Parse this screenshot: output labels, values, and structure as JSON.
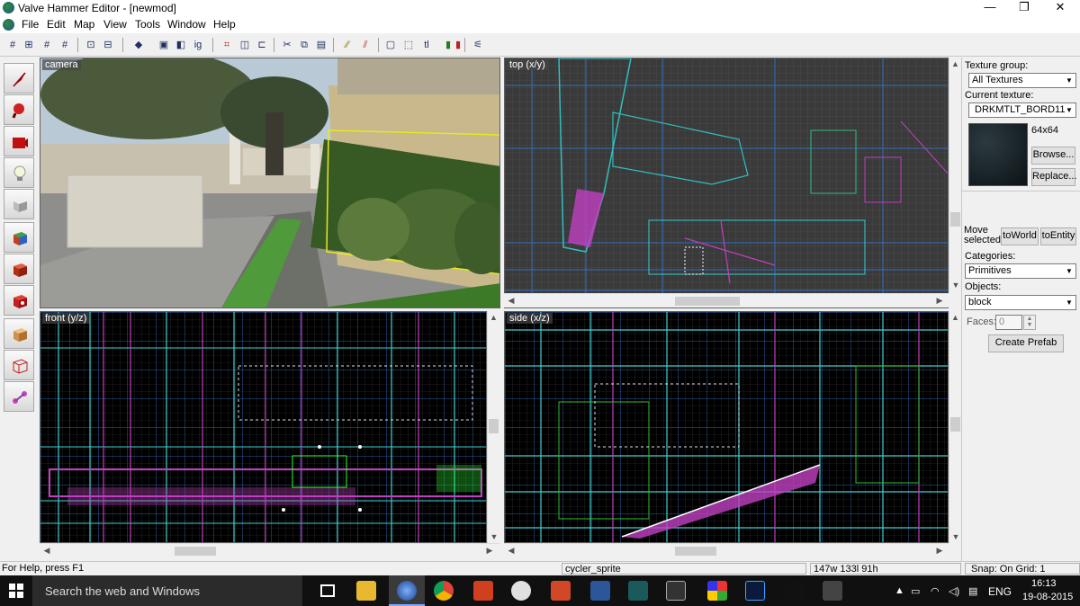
{
  "window": {
    "title": "Valve Hammer Editor - [newmod]",
    "min": "—",
    "restore": "❐",
    "close": "✕"
  },
  "menu": [
    "File",
    "Edit",
    "Map",
    "View",
    "Tools",
    "Window",
    "Help"
  ],
  "mdi": {
    "min": "_",
    "restore": "❐",
    "close": "×"
  },
  "viewports": {
    "camera": "camera",
    "top": "top (x/y)",
    "front": "front (y/z)",
    "side": "side (x/z)"
  },
  "panel": {
    "texture_group_label": "Texture group:",
    "texture_group_value": "All Textures",
    "current_texture_label": "Current texture:",
    "current_texture_value": "DRKMTLT_BORD11",
    "texture_size": "64x64",
    "browse": "Browse...",
    "replace": "Replace...",
    "move_selected": "Move selected:",
    "to_world": "toWorld",
    "to_entity": "toEntity",
    "categories_label": "Categories:",
    "categories_value": "Primitives",
    "objects_label": "Objects:",
    "objects_value": "block",
    "faces_label": "Faces:",
    "faces_value": "0",
    "create_prefab": "Create Prefab"
  },
  "status": {
    "help": "For Help, press F1",
    "entity": "cycler_sprite",
    "dims": "147w 133l 91h",
    "snap": "Snap: On Grid: 1"
  },
  "taskbar": {
    "search_placeholder": "Search the web and Windows",
    "lang": "ENG",
    "time": "16:13",
    "date": "19-08-2015"
  }
}
